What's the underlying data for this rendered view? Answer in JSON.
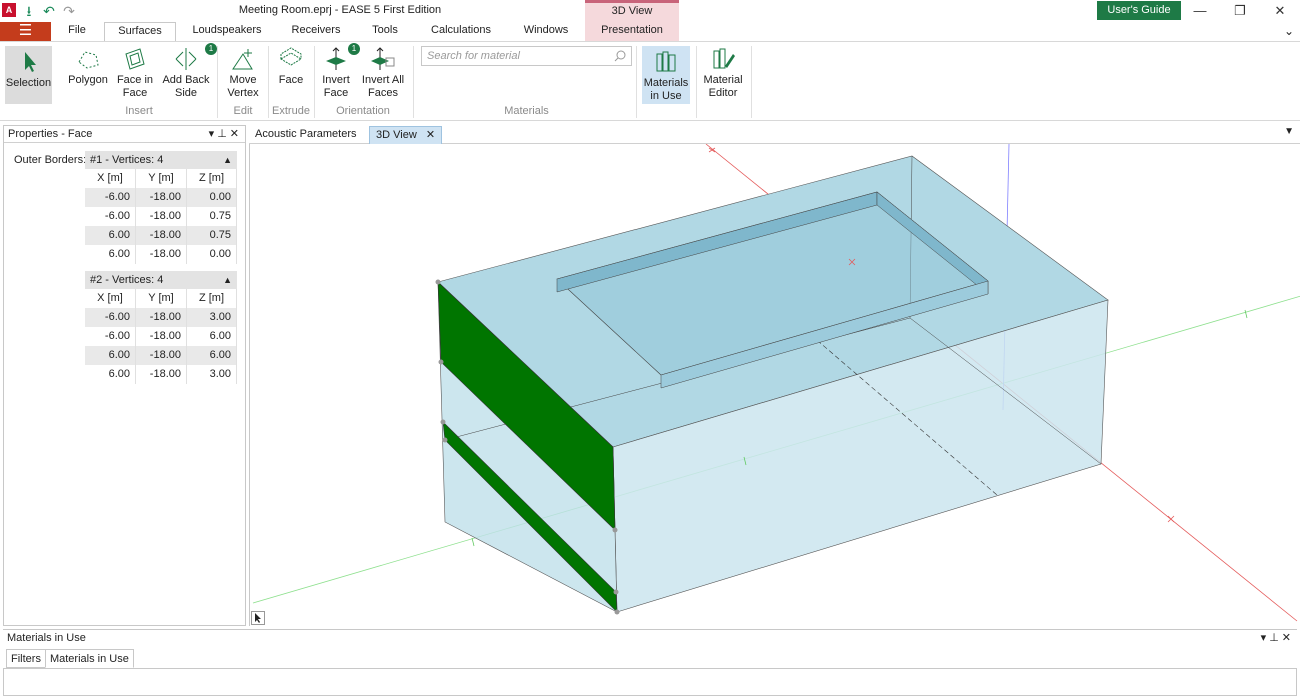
{
  "titlebar": {
    "logo": "A",
    "title": "Meeting Room.eprj - EASE 5 First Edition",
    "context_group": "3D View",
    "users_guide": "User's Guide",
    "minimize": "—",
    "restore": "❐",
    "close": "✕"
  },
  "menu": {
    "hamburger": "☰",
    "tabs": [
      "File",
      "Surfaces",
      "Loudspeakers",
      "Receivers",
      "Tools",
      "Calculations",
      "Windows",
      "Presentation"
    ],
    "active": "Surfaces",
    "collapse": "⌄"
  },
  "ribbon": {
    "selection": "Selection",
    "polygon": "Polygon",
    "face_in_face": "Face in Face",
    "add_back_side": "Add Back Side",
    "move_vertex": "Move Vertex",
    "face": "Face",
    "invert_face": "Invert Face",
    "invert_all_faces": "Invert All Faces",
    "materials_in_use": "Materials in Use",
    "material_editor": "Material Editor",
    "badge": "1",
    "groups": {
      "insert": "Insert",
      "edit": "Edit",
      "extrude": "Extrude",
      "orientation": "Orientation",
      "materials": "Materials"
    },
    "search_placeholder": "Search for material"
  },
  "properties": {
    "title": "Properties - Face",
    "outer_borders": "Outer Borders:",
    "columns": [
      "X [m]",
      "Y [m]",
      "Z [m]"
    ],
    "borders": [
      {
        "title": "#1 - Vertices: 4",
        "rows": [
          [
            "-6.00",
            "-18.00",
            "0.00"
          ],
          [
            "-6.00",
            "-18.00",
            "0.75"
          ],
          [
            "6.00",
            "-18.00",
            "0.75"
          ],
          [
            "6.00",
            "-18.00",
            "0.00"
          ]
        ]
      },
      {
        "title": "#2 - Vertices: 4",
        "rows": [
          [
            "-6.00",
            "-18.00",
            "3.00"
          ],
          [
            "-6.00",
            "-18.00",
            "6.00"
          ],
          [
            "6.00",
            "-18.00",
            "6.00"
          ],
          [
            "6.00",
            "-18.00",
            "3.00"
          ]
        ]
      }
    ]
  },
  "doc_tabs": {
    "tab1": "Acoustic Parameters",
    "tab2": "3D View",
    "close": "✕"
  },
  "bottom": {
    "title": "Materials in Use",
    "tab1": "Filters",
    "tab2": "Materials in Use"
  },
  "colors": {
    "accent_green": "#1e7a46",
    "hamburger_red": "#c43c1c",
    "context_pink": "#f5d9dc",
    "room_fill": "#aed6e3",
    "face_green": "#007500"
  }
}
